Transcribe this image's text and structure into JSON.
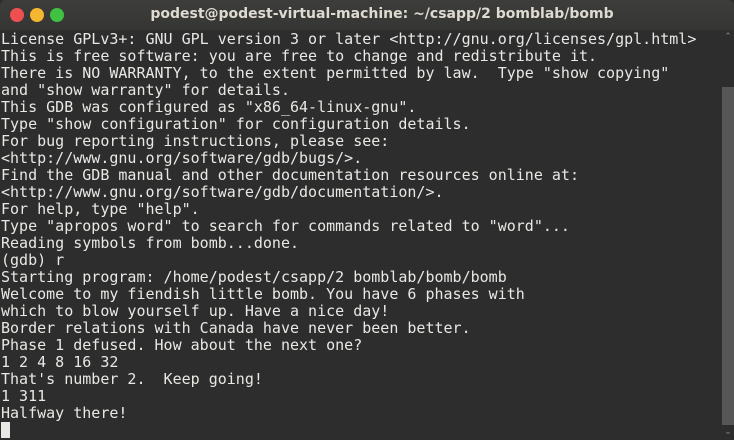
{
  "window": {
    "title": "podest@podest-virtual-machine: ~/csapp/2 bomblab/bomb"
  },
  "terminal": {
    "lines": [
      "License GPLv3+: GNU GPL version 3 or later <http://gnu.org/licenses/gpl.html>",
      "This is free software: you are free to change and redistribute it.",
      "There is NO WARRANTY, to the extent permitted by law.  Type \"show copying\"",
      "and \"show warranty\" for details.",
      "This GDB was configured as \"x86_64-linux-gnu\".",
      "Type \"show configuration\" for configuration details.",
      "For bug reporting instructions, please see:",
      "<http://www.gnu.org/software/gdb/bugs/>.",
      "Find the GDB manual and other documentation resources online at:",
      "<http://www.gnu.org/software/gdb/documentation/>.",
      "For help, type \"help\".",
      "Type \"apropos word\" to search for commands related to \"word\"...",
      "Reading symbols from bomb...done.",
      "(gdb) r",
      "Starting program: /home/podest/csapp/2 bomblab/bomb/bomb",
      "Welcome to my fiendish little bomb. You have 6 phases with",
      "which to blow yourself up. Have a nice day!",
      "Border relations with Canada have never been better.",
      "Phase 1 defused. How about the next one?",
      "1 2 4 8 16 32",
      "That's number 2.  Keep going!",
      "1 311",
      "Halfway there!"
    ]
  },
  "scrollbar": {
    "up": "⌃",
    "down": "⌄"
  }
}
